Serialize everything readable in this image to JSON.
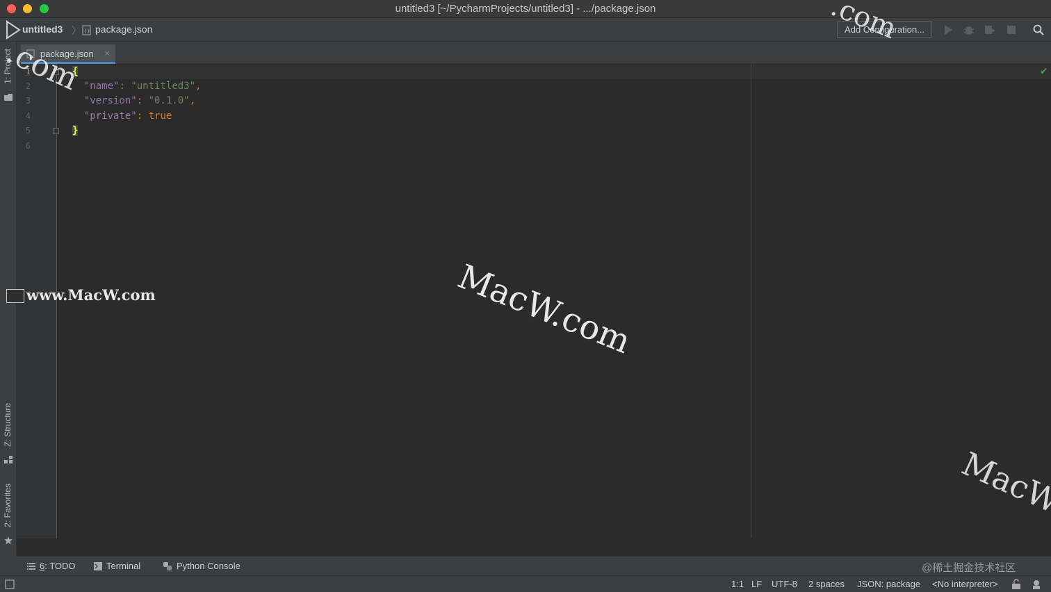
{
  "window": {
    "title": "untitled3 [~/PycharmProjects/untitled3] - .../package.json"
  },
  "navbar": {
    "project": "untitled3",
    "file": "package.json",
    "add_configuration": "Add Configuration..."
  },
  "left_strip": {
    "project": "1: Project",
    "structure": "Z: Structure",
    "favorites": "2: Favorites"
  },
  "tabs": [
    {
      "label": "package.json",
      "close": "×"
    }
  ],
  "editor": {
    "line_numbers": [
      "1",
      "2",
      "3",
      "4",
      "5",
      "6"
    ],
    "lines": {
      "l1": {
        "brace": "{"
      },
      "l2": {
        "key": "\"name\"",
        "colon": ":",
        "value": "\"untitled3\"",
        "comma": ","
      },
      "l3": {
        "key": "\"version\"",
        "colon": ":",
        "value": "\"0.1.0\"",
        "comma": ","
      },
      "l4": {
        "key": "\"private\"",
        "colon": ":",
        "value": "true"
      },
      "l5": {
        "brace": "}"
      }
    },
    "inspection_status": "✔"
  },
  "bottom_tools": {
    "todo_num": "6",
    "todo": ": TODO",
    "terminal": "Terminal",
    "python_console": "Python Console"
  },
  "status": {
    "position": "1:1",
    "line_sep": "LF",
    "encoding": "UTF-8",
    "indent": "2 spaces",
    "schema": "JSON: package",
    "interpreter": "<No interpreter>"
  },
  "watermarks": {
    "center": "MacW.com",
    "left": "www.MacW.com",
    "top_left": ".com",
    "top_right": ".com",
    "bottom_right": "MacW",
    "cn": "@稀土掘金技术社区"
  },
  "colors": {
    "accent": "#4a88c7",
    "keyword": "#cc7832",
    "string": "#6a8759",
    "json_key": "#9876aa",
    "ok_check": "#499c54"
  }
}
